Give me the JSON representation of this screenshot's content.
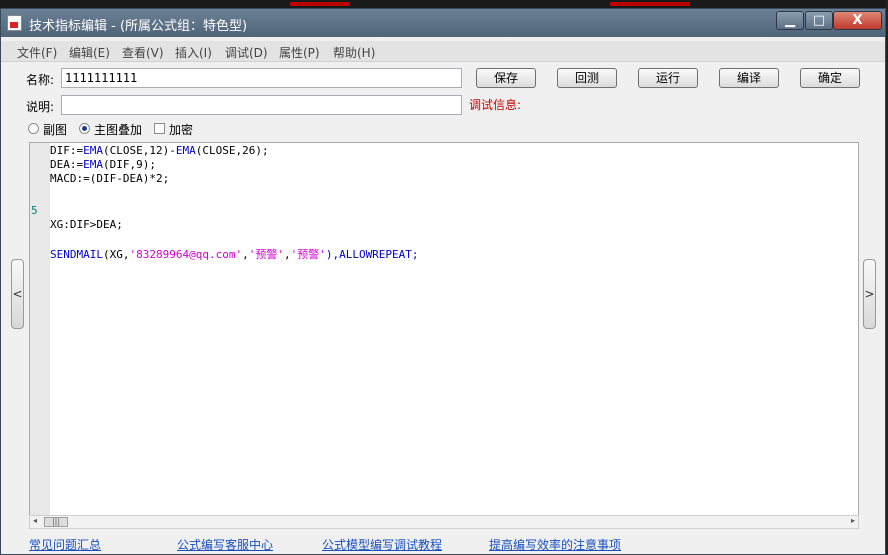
{
  "window": {
    "title": "技术指标编辑 - (所属公式组：特色型)",
    "minimize_symbol": "▁",
    "maximize_symbol": "□",
    "close_symbol": "X"
  },
  "menu": [
    "文件(F)",
    "编辑(E)",
    "查看(V)",
    "插入(I)",
    "调试(D)",
    "属性(P)",
    "帮助(H)"
  ],
  "form": {
    "name_label": "名称:",
    "name_value": "1111111111",
    "desc_label": "说明:",
    "desc_value": "",
    "debug_label": "调试信息:"
  },
  "buttons": {
    "save": "保存",
    "rollback": "回测",
    "run": "运行",
    "compile": "编译",
    "ok": "确定"
  },
  "options": {
    "sub_chart": "副图",
    "main_overlay": "主图叠加",
    "encrypt": "加密",
    "selected": "main_overlay",
    "encrypt_checked": false
  },
  "code": {
    "line1_a": "DIF:=",
    "line1_b": "EMA",
    "line1_c": "(CLOSE,12)-",
    "line1_d": "EMA",
    "line1_e": "(CLOSE,26);",
    "line2_a": "DEA:=",
    "line2_b": "EMA",
    "line2_c": "(DIF,9);",
    "line3": "MACD:=(DIF-DEA)*2;",
    "line_number": "5",
    "line6": "XG:DIF>DEA;",
    "line8_a": "SENDMAIL",
    "line8_b": "(XG,",
    "line8_c": "'83289964@qq.com'",
    "line8_d": ",",
    "line8_e": "'预警'",
    "line8_f": ",",
    "line8_g": "'预警'",
    "line8_h": "),ALLOWREPEAT;"
  },
  "footer_links": [
    "常见问题汇总",
    "公式编写客服中心",
    "公式模型编写调试教程",
    "提高编写效率的注意事项"
  ],
  "scroll": {
    "thumb_glyph": "|||",
    "left_arrow": "◂",
    "right_arrow": "▸",
    "side_left": "<",
    "side_right": ">"
  }
}
